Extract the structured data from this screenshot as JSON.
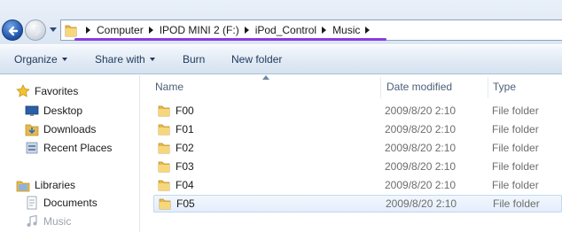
{
  "address_bar": {
    "breadcrumbs": [
      "Computer",
      "IPOD MINI 2 (F:)",
      "iPod_Control",
      "Music"
    ]
  },
  "toolbar": {
    "organize_label": "Organize",
    "share_label": "Share with",
    "burn_label": "Burn",
    "new_folder_label": "New folder"
  },
  "nav_pane": {
    "favorites_label": "Favorites",
    "favorites": [
      "Desktop",
      "Downloads",
      "Recent Places"
    ],
    "libraries_label": "Libraries",
    "libraries": [
      "Documents",
      "Music"
    ]
  },
  "list": {
    "columns": {
      "name": "Name",
      "date": "Date modified",
      "type": "Type"
    },
    "rows": [
      {
        "name": "F00",
        "date": "2009/8/20 2:10",
        "type": "File folder"
      },
      {
        "name": "F01",
        "date": "2009/8/20 2:10",
        "type": "File folder"
      },
      {
        "name": "F02",
        "date": "2009/8/20 2:10",
        "type": "File folder"
      },
      {
        "name": "F03",
        "date": "2009/8/20 2:10",
        "type": "File folder"
      },
      {
        "name": "F04",
        "date": "2009/8/20 2:10",
        "type": "File folder"
      },
      {
        "name": "F05",
        "date": "2009/8/20 2:10",
        "type": "File folder"
      }
    ]
  },
  "colors": {
    "address_highlight": "#8a3be0",
    "toolbar_text": "#1e395b",
    "selection_border": "#c2d8f0"
  }
}
